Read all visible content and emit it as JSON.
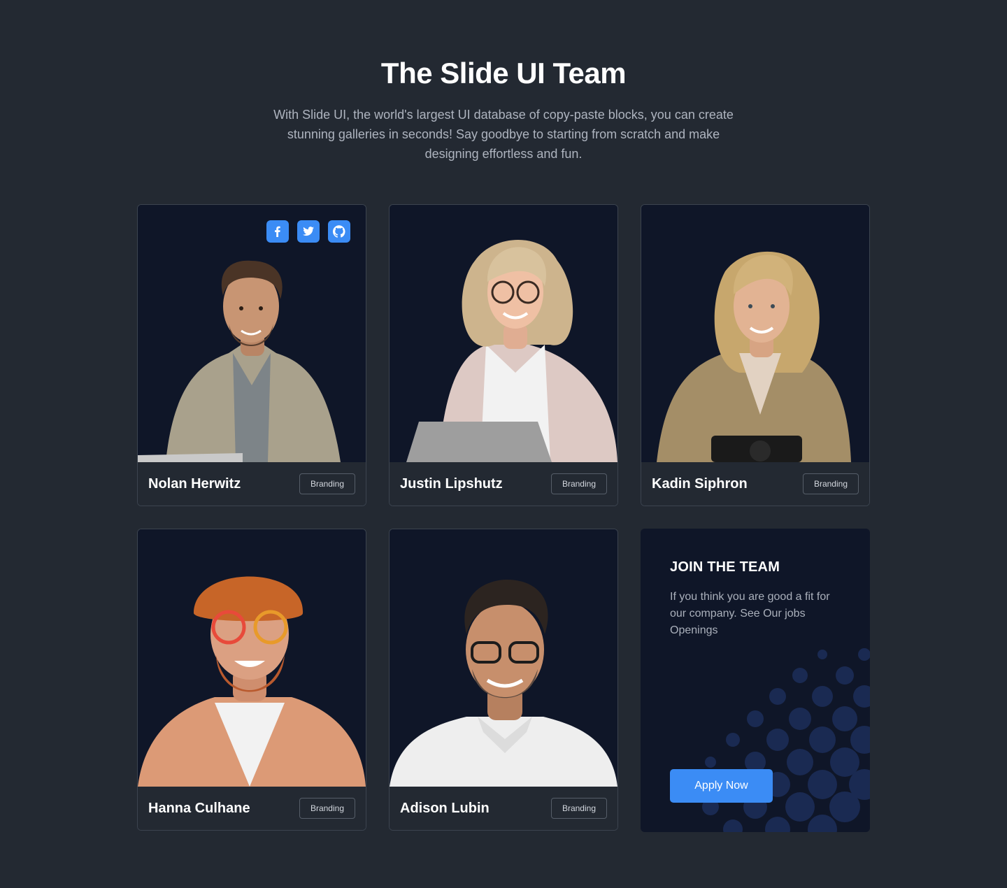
{
  "header": {
    "title": "The Slide UI Team",
    "subtitle": "With Slide UI, the world's largest UI database of copy-paste blocks, you can create stunning galleries in seconds! Say goodbye to starting from scratch and make designing effortless and fun."
  },
  "team": [
    {
      "name": "Nolan Herwitz",
      "tag": "Branding"
    },
    {
      "name": "Justin Lipshutz",
      "tag": "Branding"
    },
    {
      "name": "Kadin Siphron",
      "tag": "Branding"
    },
    {
      "name": "Hanna Culhane",
      "tag": "Branding"
    },
    {
      "name": "Adison Lubin",
      "tag": "Branding"
    }
  ],
  "social_icons": [
    "facebook-icon",
    "twitter-icon",
    "github-icon"
  ],
  "join": {
    "title": "JOIN THE TEAM",
    "text": "If you think you are good a fit for our company. See Our jobs Openings",
    "button_label": "Apply Now"
  },
  "colors": {
    "background": "#232932",
    "card_background": "#0f1628",
    "accent": "#3b8cf5",
    "subtitle": "#aeb4bf"
  }
}
